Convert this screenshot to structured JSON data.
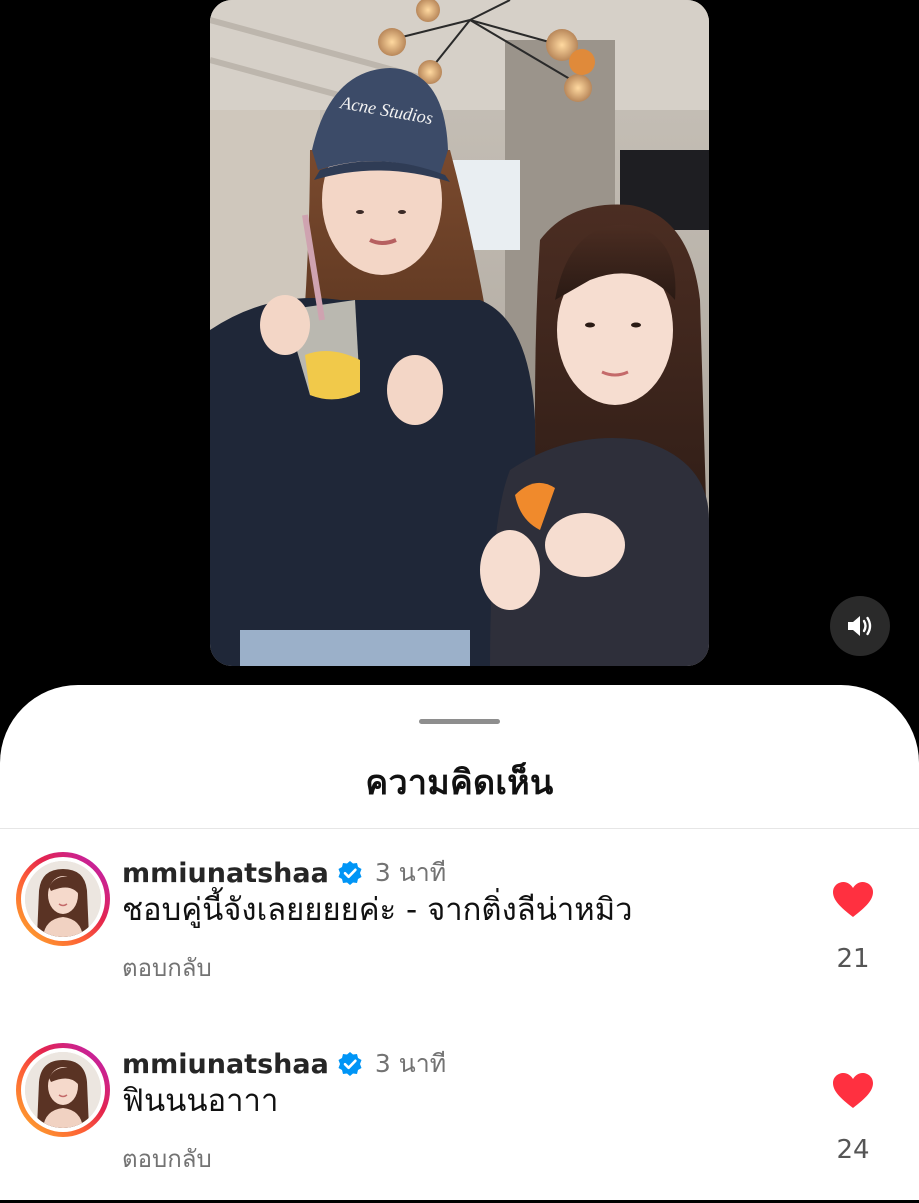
{
  "video": {
    "cap_text": "Acne Studios",
    "sound_icon": "speaker-icon"
  },
  "sheet": {
    "title": "ความคิดเห็น"
  },
  "comments": [
    {
      "username": "mmiunatshaa",
      "verified": true,
      "timestamp": "3 นาที",
      "text": "ชอบคู่นี้จังเลยยยยค่ะ - จากติ่งลีน่าหมิว",
      "reply_label": "ตอบกลับ",
      "likes": "21",
      "liked": true
    },
    {
      "username": "mmiunatshaa",
      "verified": true,
      "timestamp": "3 นาที",
      "text": "ฟินนนอาาา",
      "reply_label": "ตอบกลับ",
      "likes": "24",
      "liked": true
    }
  ],
  "colors": {
    "like_red": "#ff3040",
    "verified_blue": "#0095f6",
    "secondary_text": "#737373"
  }
}
